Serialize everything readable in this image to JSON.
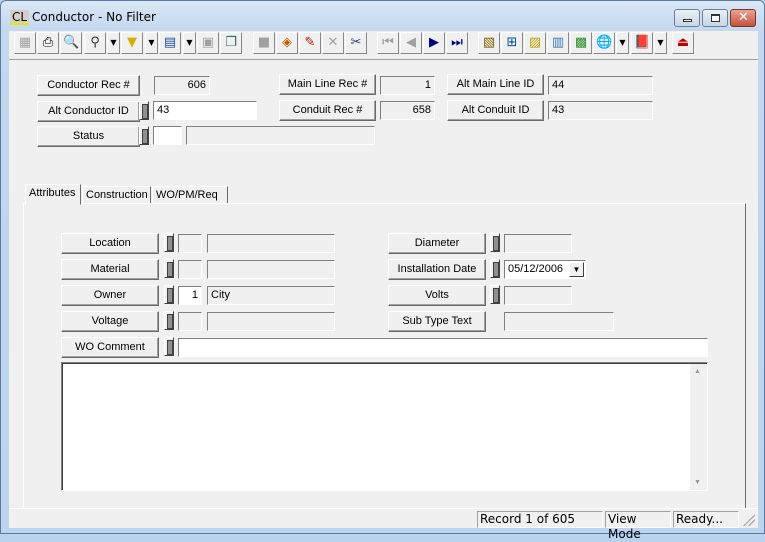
{
  "window": {
    "app_icon": "CL",
    "title": "Conductor - No Filter",
    "controls": {
      "minimize": "minimize-icon",
      "maximize": "maximize-icon",
      "close": "close-icon"
    }
  },
  "toolbar": {
    "buttons": [
      {
        "name": "view-grid",
        "icon": "grid-icon",
        "glyph": "▦",
        "enabled": false
      },
      {
        "name": "print",
        "icon": "printer-icon",
        "glyph": "⎙",
        "enabled": true
      },
      {
        "name": "print-preview",
        "icon": "magnifier-icon",
        "glyph": "🔍",
        "enabled": true
      },
      {
        "name": "find",
        "icon": "binoculars-icon",
        "glyph": "⚲",
        "enabled": true
      },
      {
        "name": "filter",
        "icon": "funnel-icon",
        "glyph": "▼",
        "enabled": true
      },
      {
        "name": "report",
        "icon": "report-icon",
        "glyph": "▤",
        "enabled": true
      },
      {
        "name": "properties",
        "icon": "properties-icon",
        "glyph": "▣",
        "enabled": false
      },
      {
        "name": "copy",
        "icon": "copy-icon",
        "glyph": "❐",
        "enabled": true
      },
      {
        "name": "save",
        "icon": "save-icon",
        "glyph": "■",
        "enabled": false
      },
      {
        "name": "add",
        "icon": "add-stack-icon",
        "glyph": "◈",
        "enabled": true
      },
      {
        "name": "edit",
        "icon": "pencil-icon",
        "glyph": "✎",
        "enabled": true
      },
      {
        "name": "delete",
        "icon": "delete-x-icon",
        "glyph": "✕",
        "enabled": false
      },
      {
        "name": "cut",
        "icon": "scissors-icon",
        "glyph": "✂",
        "enabled": true
      },
      {
        "name": "first",
        "icon": "first-record-icon",
        "glyph": "⏮",
        "enabled": false
      },
      {
        "name": "previous",
        "icon": "previous-record-icon",
        "glyph": "◀",
        "enabled": false
      },
      {
        "name": "next",
        "icon": "next-record-icon",
        "glyph": "▶",
        "enabled": true
      },
      {
        "name": "last",
        "icon": "last-record-icon",
        "glyph": "⏭",
        "enabled": true
      },
      {
        "name": "related-records",
        "icon": "related-icon",
        "glyph": "▧",
        "enabled": true
      },
      {
        "name": "hierarchy",
        "icon": "hierarchy-icon",
        "glyph": "⊞",
        "enabled": true
      },
      {
        "name": "equipment",
        "icon": "equipment-icon",
        "glyph": "▨",
        "enabled": true
      },
      {
        "name": "calculator",
        "icon": "calculator-icon",
        "glyph": "▥",
        "enabled": true
      },
      {
        "name": "map-chart",
        "icon": "chart-icon",
        "glyph": "▩",
        "enabled": true
      },
      {
        "name": "gis",
        "icon": "globe-icon",
        "glyph": "🌐",
        "enabled": true
      },
      {
        "name": "help-book",
        "icon": "book-icon",
        "glyph": "📕",
        "enabled": true
      },
      {
        "name": "exit",
        "icon": "exit-icon",
        "glyph": "⏏",
        "enabled": true
      }
    ]
  },
  "header_fields": {
    "conductor_rec": {
      "label": "Conductor Rec #",
      "value": "606"
    },
    "alt_conductor_id": {
      "label": "Alt Conductor ID",
      "value": "43"
    },
    "status": {
      "label": "Status",
      "code": "",
      "description": ""
    },
    "main_line_rec": {
      "label": "Main Line Rec #",
      "value": "1"
    },
    "conduit_rec": {
      "label": "Conduit Rec #",
      "value": "658"
    },
    "alt_main_line_id": {
      "label": "Alt Main Line ID",
      "value": "44"
    },
    "alt_conduit_id": {
      "label": "Alt Conduit ID",
      "value": "43"
    }
  },
  "tabs": [
    {
      "label": "Attributes",
      "active": true
    },
    {
      "label": "Construction",
      "active": false
    },
    {
      "label": "WO/PM/Req",
      "active": false
    }
  ],
  "attributes": {
    "location": {
      "label": "Location",
      "code": "",
      "description": ""
    },
    "material": {
      "label": "Material",
      "code": "",
      "description": ""
    },
    "owner": {
      "label": "Owner",
      "code": "1",
      "description": "City"
    },
    "voltage": {
      "label": "Voltage",
      "code": "",
      "description": ""
    },
    "wo_comment": {
      "label": "WO Comment",
      "value": ""
    },
    "diameter": {
      "label": "Diameter",
      "value": ""
    },
    "installation_date": {
      "label": "Installation Date",
      "value": "05/12/2006"
    },
    "volts": {
      "label": "Volts",
      "value": ""
    },
    "sub_type_text": {
      "label": "Sub Type Text",
      "value": ""
    },
    "comment_memo": ""
  },
  "statusbar": {
    "record": "Record 1 of 605",
    "mode": "View Mode",
    "state": "Ready..."
  }
}
